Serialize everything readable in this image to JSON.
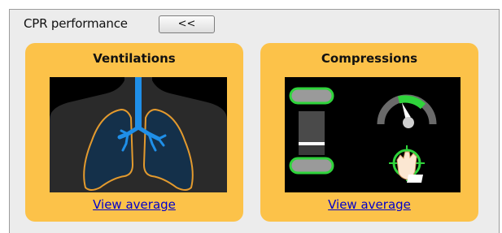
{
  "header": {
    "title": "CPR performance",
    "collapse_label": "<<"
  },
  "cards": [
    {
      "title": "Ventilations",
      "icon": "lungs-icon",
      "link_label": "View average"
    },
    {
      "title": "Compressions",
      "icons": [
        "compression-depth-icon",
        "rate-gauge-icon",
        "hand-position-icon"
      ],
      "link_label": "View average"
    }
  ],
  "colors": {
    "card_background": "#fcc249",
    "image_background": "#000000",
    "airway_blue": "#1f8fe8",
    "lung_outline": "#e39a2e",
    "indicator_green": "#2fd43b",
    "link_blue": "#0000cc"
  }
}
